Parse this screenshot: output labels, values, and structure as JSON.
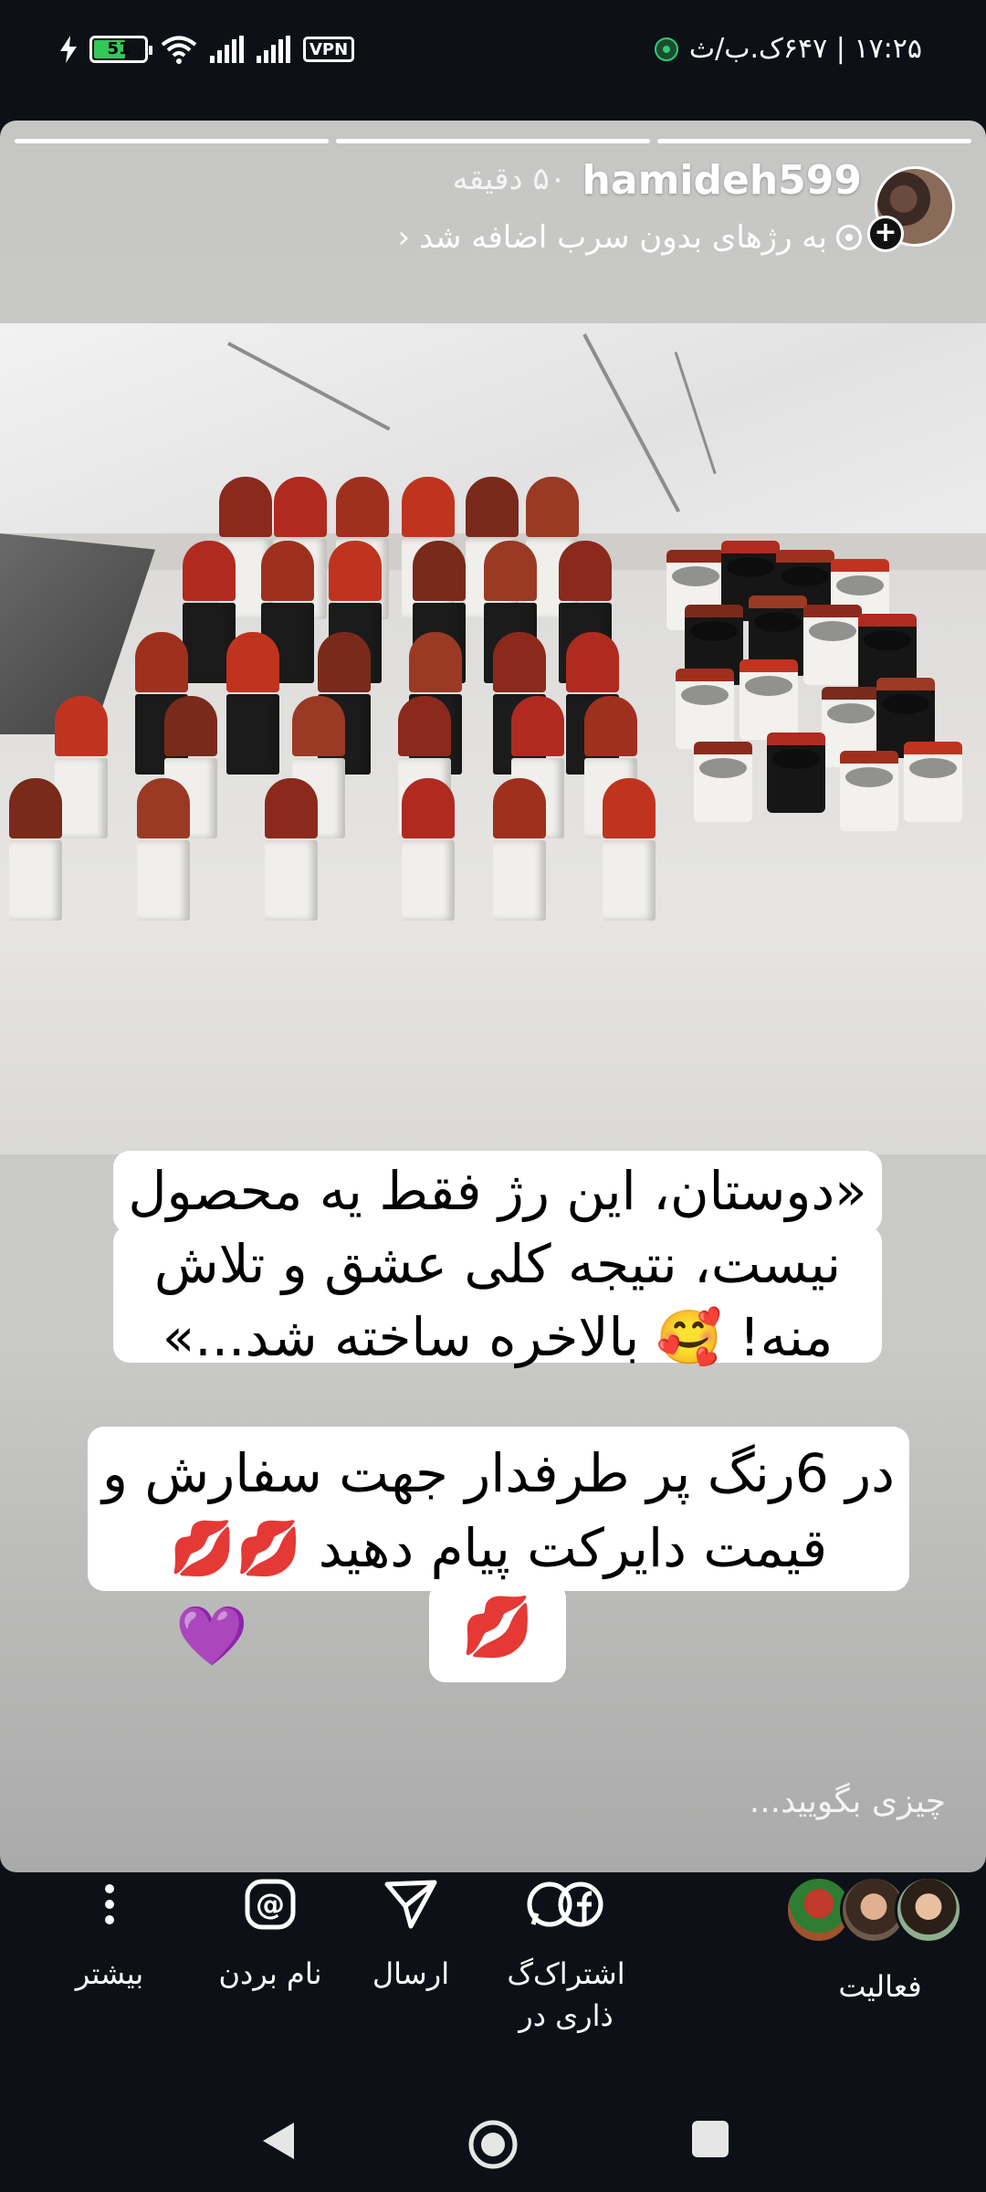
{
  "status_bar": {
    "battery_level": "51",
    "vpn_label": "VPN",
    "time_and_data": "۱۷:۲۵ | ۶۴۷ک.ب/ث"
  },
  "story": {
    "username": "hamideh599",
    "time_ago": "۵۰ دقیقه",
    "subtitle": "به رژهای بدون سرب اضافه شد",
    "progress_segments": 3,
    "active_segment": 3,
    "caption_1": "«دوستان، این رژ فقط یه محصول نیست، نتیجه کلی عشق و تلاش منه! 🥰 بالاخره ساخته شد...»",
    "caption_1_lines": [
      "«دوستان، این رژ فقط یه محصول",
      "نیست، نتیجه کلی عشق و تلاش",
      "منه! 🥰 بالاخره ساخته شد...»"
    ],
    "caption_2_lines": [
      "در 6رنگ پر طرفدار جهت سفارش و",
      "قیمت دایرکت پیام دهید 💋💋"
    ],
    "caption_2_tail": "💋",
    "heart_emoji": "💜",
    "reply_placeholder": "چیزی بگویید..."
  },
  "toolbar": {
    "more_label": "بیشتر",
    "mention_label": "نام بردن",
    "send_label": "ارسال",
    "share_label_line1": "اشتراک‌گ",
    "share_label_line2": "ذاری در",
    "activity_label": "فعالیت"
  },
  "icons": {
    "more": "more-vertical-icon",
    "mention": "at-sign-icon",
    "send": "send-icon",
    "share": "whatsapp-facebook-icon"
  },
  "colors": {
    "background": "#0d1117",
    "lipstick_red": "#c6162a"
  }
}
